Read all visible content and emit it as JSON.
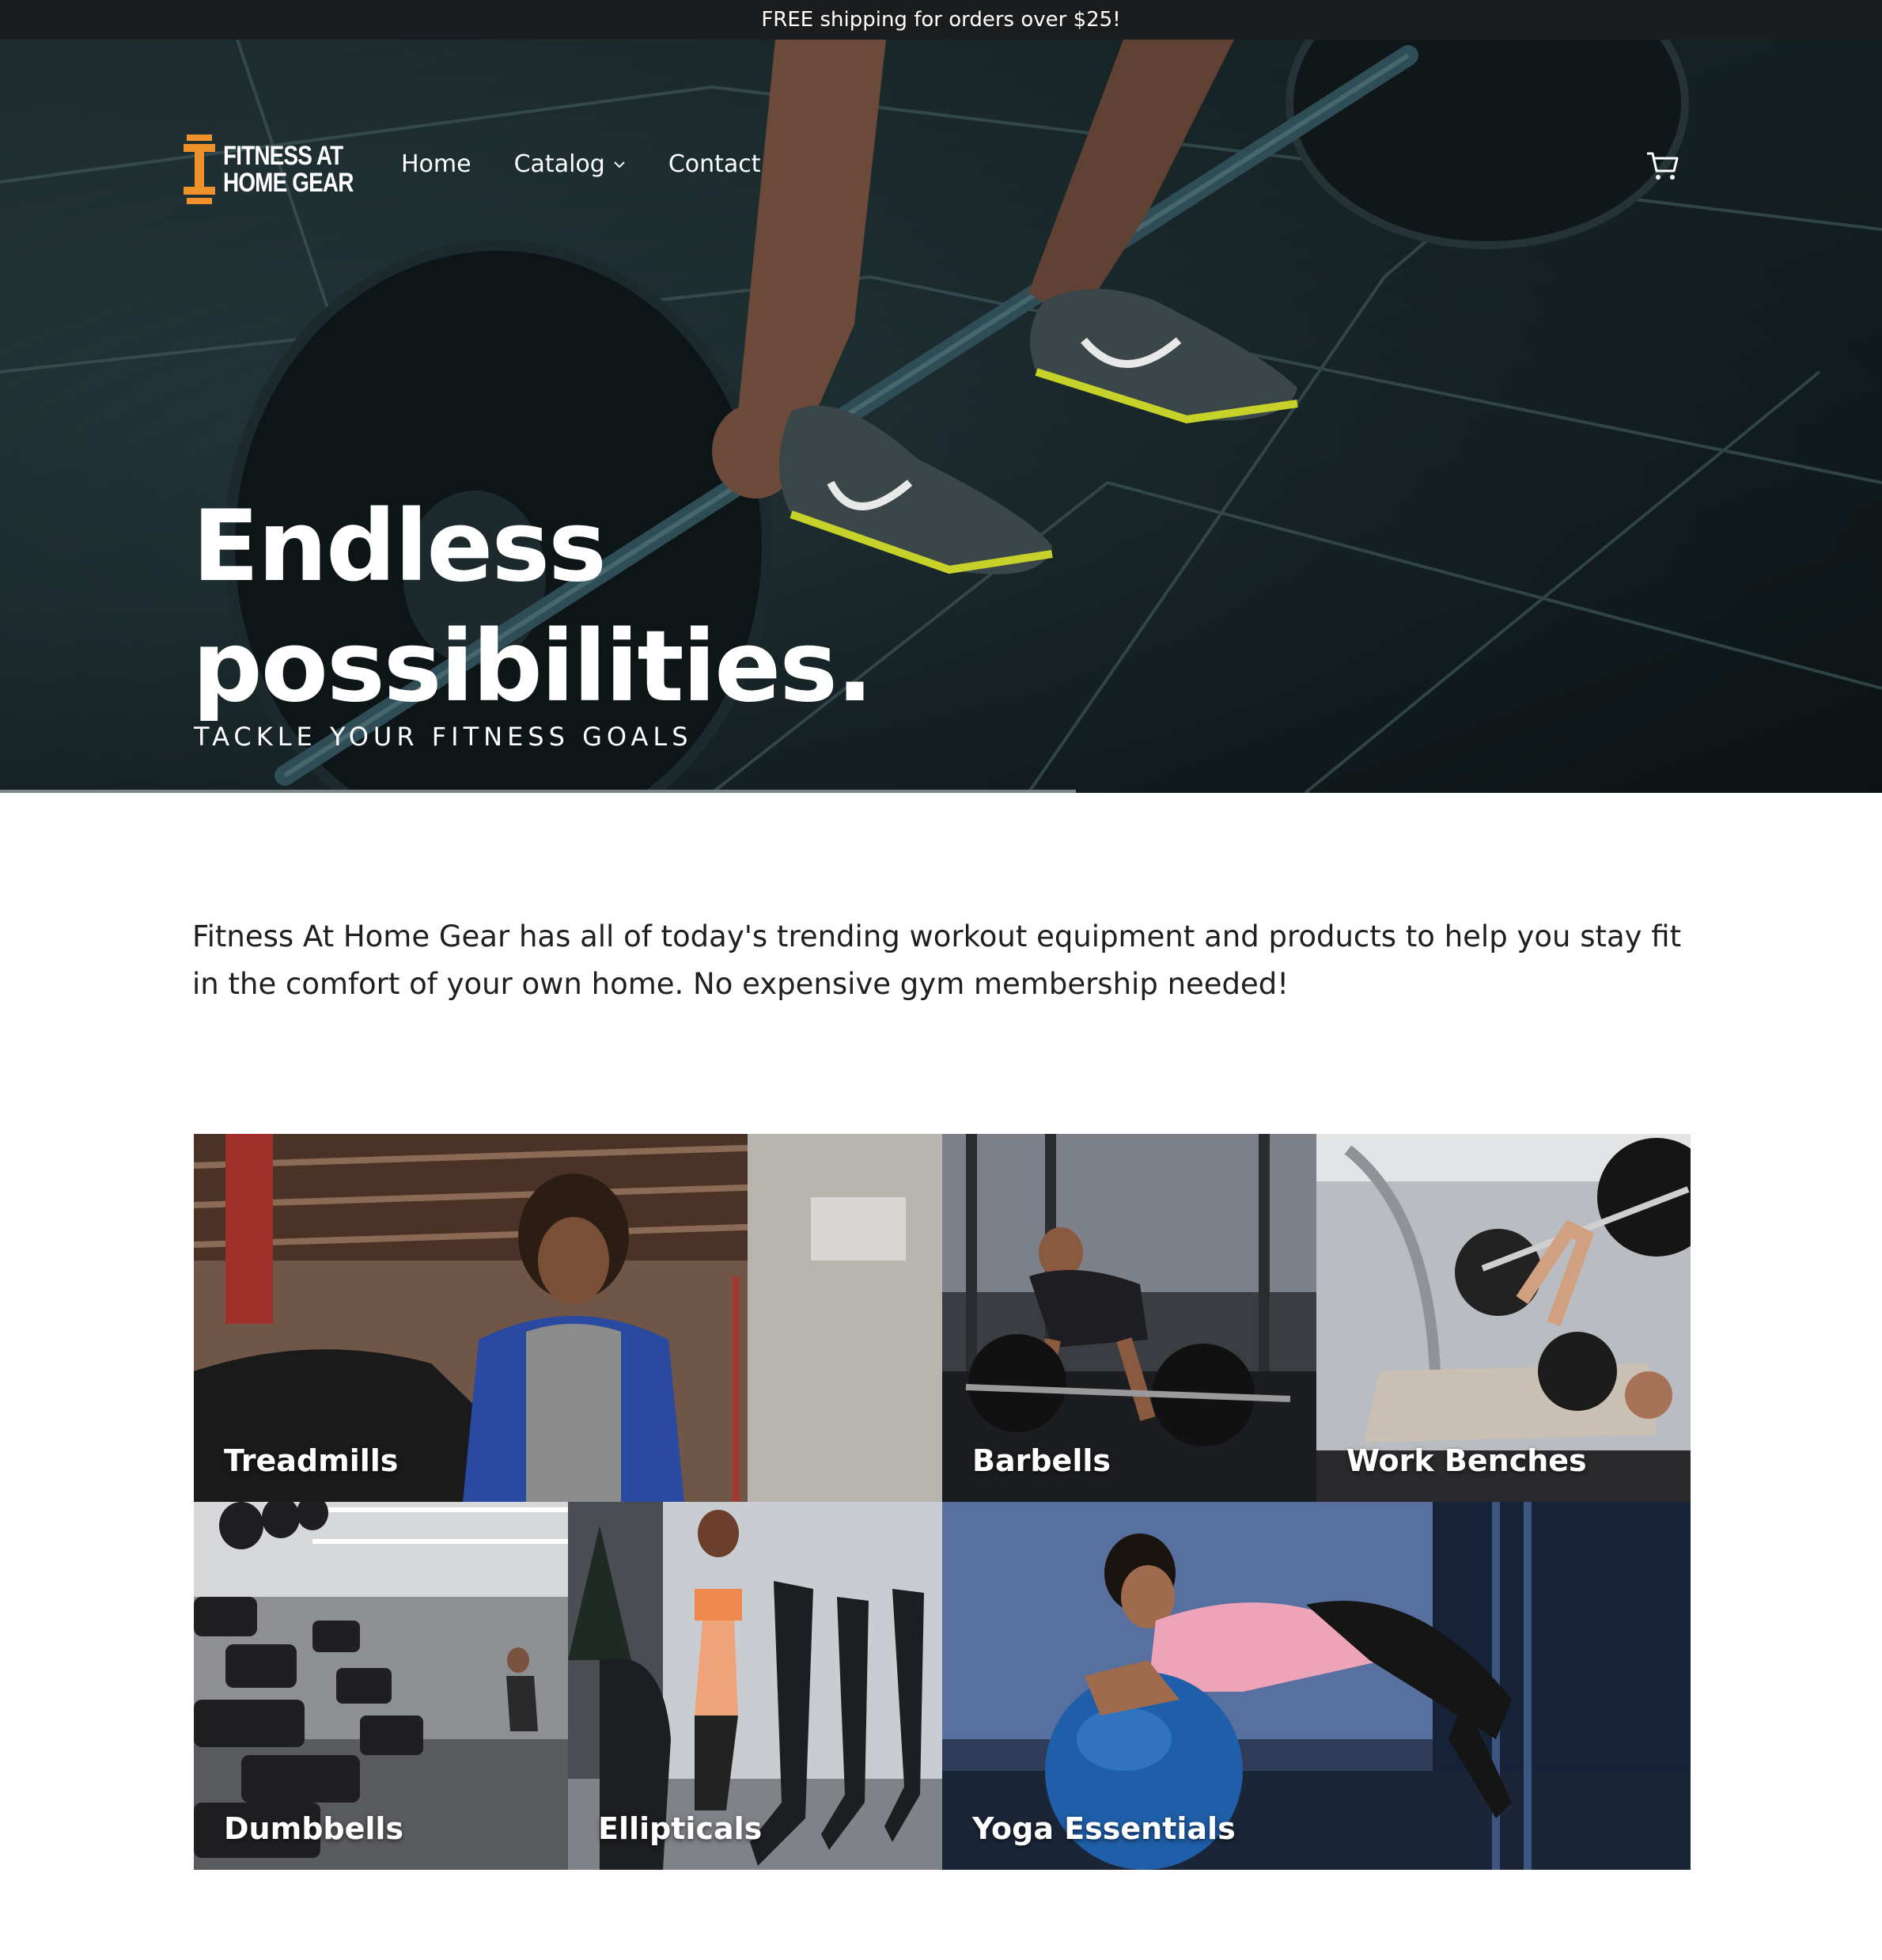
{
  "announcement": "FREE shipping for orders over $25!",
  "brand": {
    "name": "FITNESS AT\nHOME GEAR",
    "accent": "#f0922b"
  },
  "nav": {
    "items": [
      {
        "label": "Home"
      },
      {
        "label": "Catalog"
      },
      {
        "label": "Contact"
      }
    ]
  },
  "hero": {
    "title": "Endless possibilities.",
    "subtitle": "TACKLE YOUR FITNESS GOALS"
  },
  "intro": "Fitness At Home Gear has all of today's trending workout equipment and products to help you stay fit in the comfort of your own home. No expensive gym membership needed!",
  "collections": [
    {
      "label": "Treadmills"
    },
    {
      "label": "Barbells"
    },
    {
      "label": "Work Benches"
    },
    {
      "label": "Dumbbells"
    },
    {
      "label": "Ellipticals"
    },
    {
      "label": "Yoga Essentials"
    }
  ],
  "icons": [
    "dumbbell-logo-icon",
    "chevron-down-icon",
    "cart-icon"
  ]
}
